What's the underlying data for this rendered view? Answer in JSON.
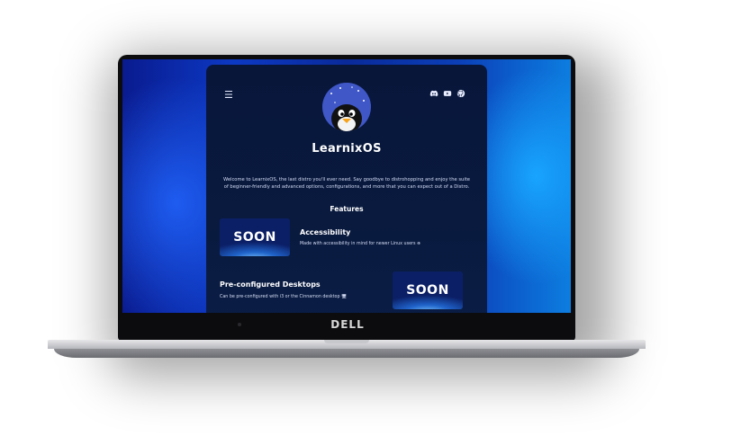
{
  "device": {
    "brand": "DELL"
  },
  "header": {
    "menu_icon": "hamburger-icon",
    "icons": [
      "discord-icon",
      "youtube-icon",
      "github-icon"
    ]
  },
  "site": {
    "title": "LearnixOS",
    "intro": "Welcome to LearnixOS, the last distro you'll ever need. Say goodbye to distrohopping and enjoy the suite of beginner-friendly and advanced options, configurations, and more that you can expect out of a Distro."
  },
  "features": {
    "heading": "Features",
    "items": [
      {
        "image_text": "SOON",
        "title": "Accessibility",
        "description": "Made with accessibility in mind for newer Linux users ⊕"
      },
      {
        "image_text": "SOON",
        "title": "Pre-configured Desktops",
        "description": "Can be pre-configured with i3 or the Cinnamon desktop 🖥"
      }
    ]
  },
  "colors": {
    "panel_bg": "#08163a",
    "screen_blue": "#0c39c4",
    "accent_cyan": "#18a4ff"
  }
}
